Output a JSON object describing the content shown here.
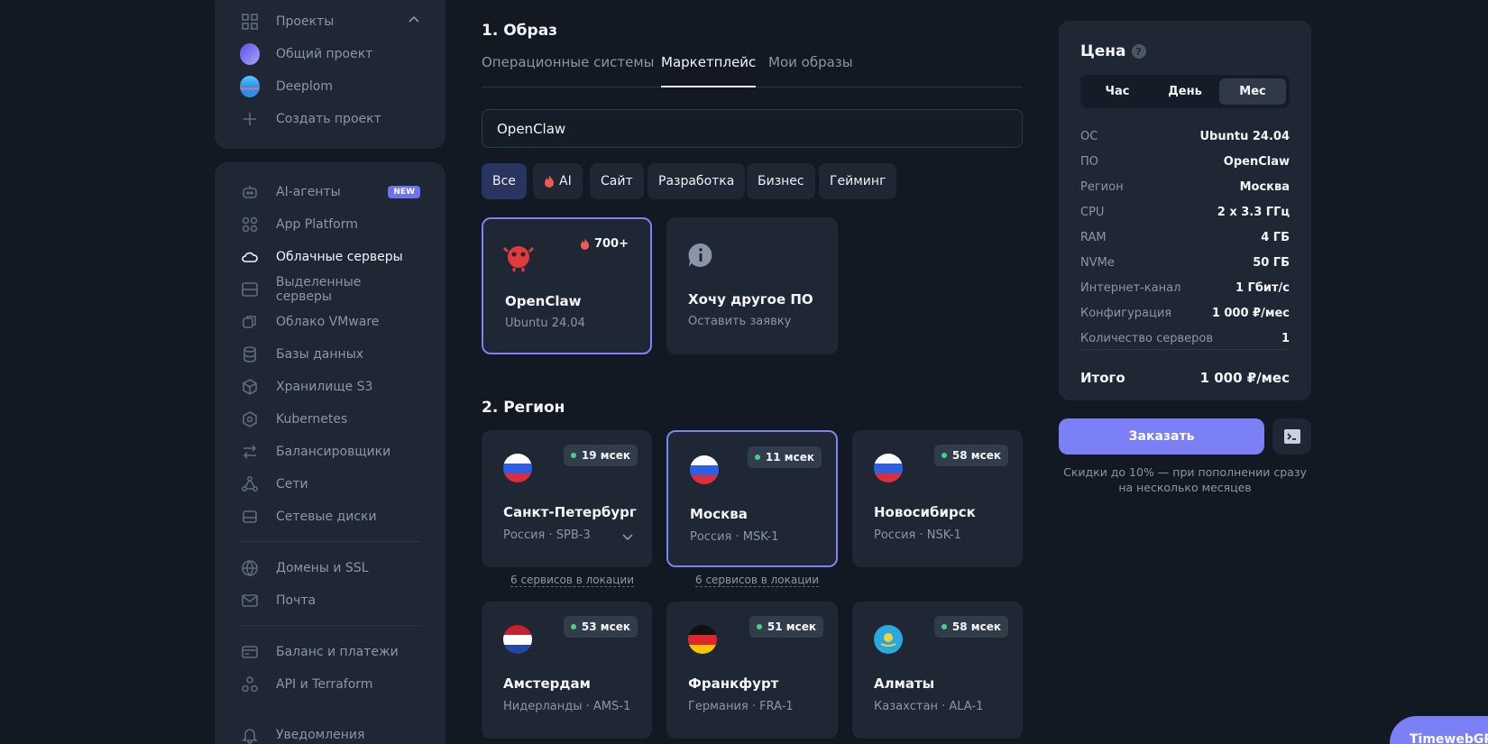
{
  "sidebar_top": {
    "projects_label": "Проекты",
    "items": [
      {
        "label": "Общий проект"
      },
      {
        "label": "Deeplom"
      },
      {
        "label": "Создать проект"
      }
    ]
  },
  "sidebar": {
    "new_badge": "NEW",
    "items": [
      {
        "label": "AI-агенты",
        "icon": "robot-icon"
      },
      {
        "label": "App Platform",
        "icon": "grid-icon"
      },
      {
        "label": "Облачные серверы",
        "icon": "cloud-icon"
      },
      {
        "label": "Выделенные серверы",
        "icon": "server-icon"
      },
      {
        "label": "Облако VMware",
        "icon": "vmware-icon"
      },
      {
        "label": "Базы данных",
        "icon": "database-icon"
      },
      {
        "label": "Хранилище S3",
        "icon": "cube-icon"
      },
      {
        "label": "Kubernetes",
        "icon": "kubernetes-icon"
      },
      {
        "label": "Балансировщики",
        "icon": "swap-icon"
      },
      {
        "label": "Сети",
        "icon": "network-icon"
      },
      {
        "label": "Сетевые диски",
        "icon": "disk-icon"
      },
      {
        "label": "Домены и SSL",
        "icon": "globe-icon"
      },
      {
        "label": "Почта",
        "icon": "mail-icon"
      },
      {
        "label": "Баланс и платежи",
        "icon": "card-icon"
      },
      {
        "label": "API и Terraform",
        "icon": "api-icon"
      },
      {
        "label": "Уведомления",
        "icon": "bell-icon"
      }
    ]
  },
  "image_section": {
    "heading": "1. Образ",
    "tabs": [
      "Операционные системы",
      "Маркетплейс",
      "Мои образы"
    ],
    "search_value": "OpenClaw",
    "chips": [
      "Все",
      "AI",
      "Сайт",
      "Разработка",
      "Бизнес",
      "Гейминг"
    ],
    "cards": [
      {
        "title": "OpenClaw",
        "sub": "Ubuntu 24.04",
        "badge": "700+"
      },
      {
        "title": "Хочу другое ПО",
        "sub": "Оставить заявку"
      }
    ]
  },
  "region_section": {
    "heading": "2. Регион",
    "services_link": "6 сервисов в локации",
    "regions": [
      {
        "city": "Санкт-Петербург",
        "code": "Россия · SPB-3",
        "ping": "19 мсек"
      },
      {
        "city": "Москва",
        "code": "Россия · MSK-1",
        "ping": "11 мсек"
      },
      {
        "city": "Новосибирск",
        "code": "Россия · NSK-1",
        "ping": "58 мсек"
      },
      {
        "city": "Амстердам",
        "code": "Нидерланды · AMS-1",
        "ping": "53 мсек"
      },
      {
        "city": "Франкфурт",
        "code": "Германия · FRA-1",
        "ping": "51 мсек"
      },
      {
        "city": "Алматы",
        "code": "Казахстан · ALA-1",
        "ping": "58 мсек"
      }
    ]
  },
  "price": {
    "title": "Цена",
    "help": "?",
    "periods": [
      "Час",
      "День",
      "Мес"
    ],
    "rows": [
      {
        "k": "ОС",
        "v": "Ubuntu 24.04"
      },
      {
        "k": "ПО",
        "v": "OpenClaw"
      },
      {
        "k": "Регион",
        "v": "Москва"
      },
      {
        "k": "CPU",
        "v": "2 x 3.3 ГГц"
      },
      {
        "k": "RAM",
        "v": "4 ГБ"
      },
      {
        "k": "NVMe",
        "v": "50 ГБ"
      },
      {
        "k": "Интернет-канал",
        "v": "1 Гбит/с"
      },
      {
        "k": "Конфигурация",
        "v": "1 000 ₽/мес"
      },
      {
        "k": "Количество серверов",
        "v": "1"
      }
    ],
    "total_label": "Итого",
    "total_value": "1 000 ₽/мес"
  },
  "order": {
    "button": "Заказать",
    "discount_line1": "Скидки до 10% — при пополнении сразу",
    "discount_line2": "на несколько месяцев"
  },
  "assistant": {
    "label": "TimewebGPT"
  },
  "colors": {
    "accent": "#7c80f6",
    "background": "#121923",
    "card": "#1e2733",
    "ping_dot": "#4ccf8a"
  }
}
